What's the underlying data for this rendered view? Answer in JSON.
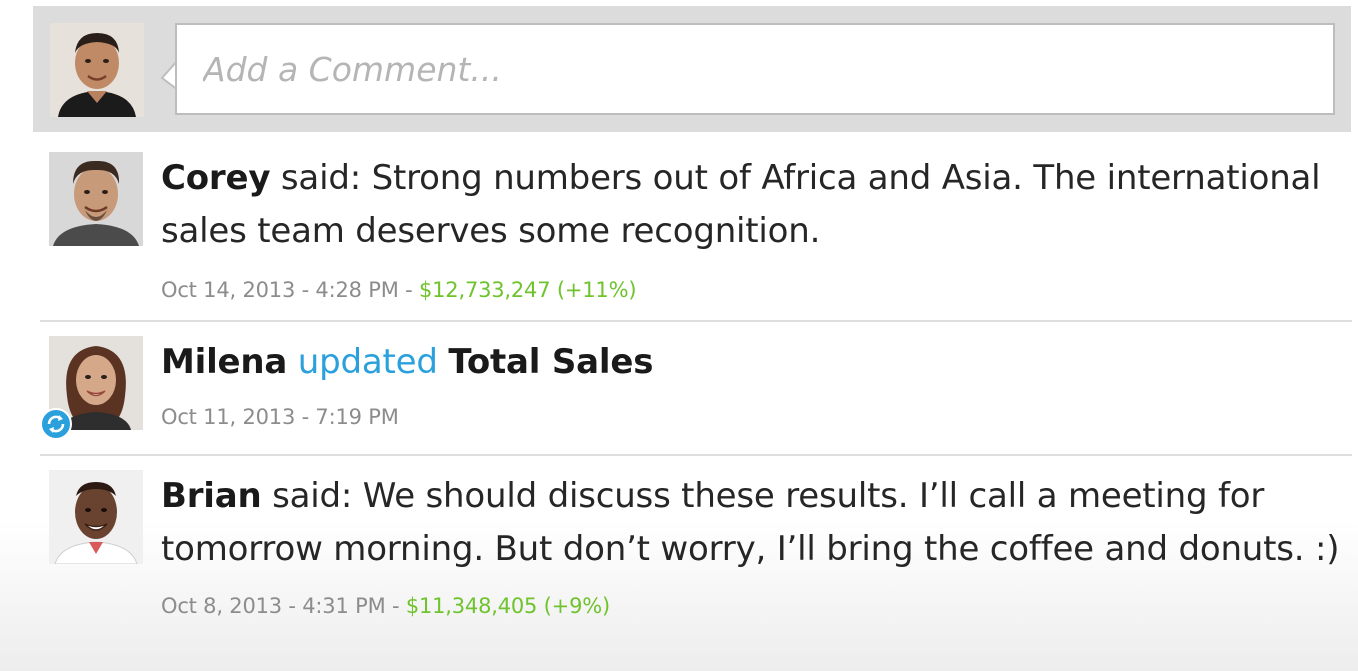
{
  "composer": {
    "placeholder": "Add a Comment..."
  },
  "feed": [
    {
      "author": "Corey",
      "verb": "said:",
      "text": "Strong numbers out of Africa and Asia. The international sales team deserves some recognition.",
      "date": "Oct 14, 2013 - 4:28 PM - ",
      "value": "$12,733,247 (+11%)"
    },
    {
      "author": "Milena",
      "action": "updated",
      "target": "Total Sales",
      "date": "Oct 11, 2013 - 7:19 PM"
    },
    {
      "author": "Brian",
      "verb": "said:",
      "text": "We should discuss these results. I’ll call a meeting for tomorrow morning. But don’t worry, I’ll bring the coffee and donuts. :)",
      "date": "Oct 8, 2013 - 4:31 PM - ",
      "value": "$11,348,405 (+9%)"
    }
  ],
  "colors": {
    "accent": "#2aa0dc",
    "positive": "#6fc32d",
    "meta": "#8c8c8c",
    "composer_bg": "#dcdcdc"
  },
  "icons": {
    "update_badge": "sync-icon"
  }
}
